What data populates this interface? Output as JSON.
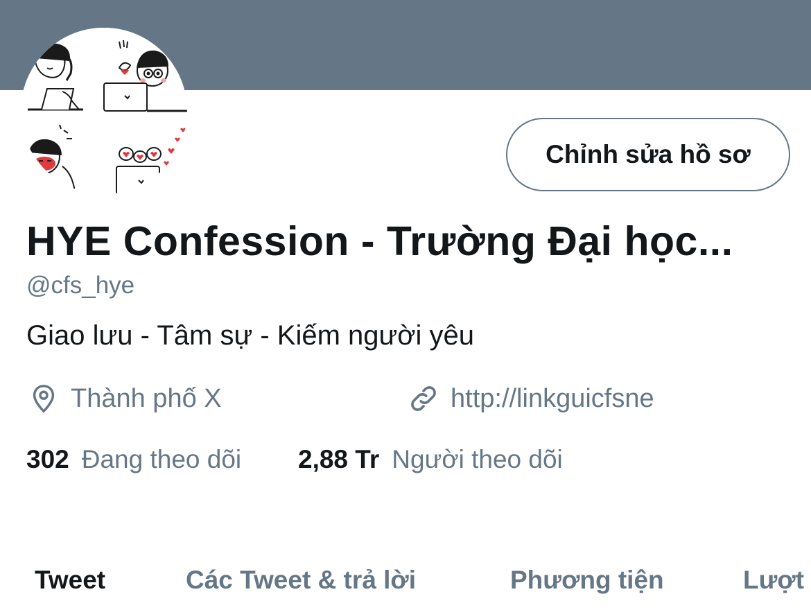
{
  "profile": {
    "edit_button": "Chỉnh sửa hồ sơ",
    "display_name": "HYE Confession - Trường Đại học...",
    "handle": "@cfs_hye",
    "bio": "Giao lưu - Tâm sự - Kiếm người yêu",
    "location": "Thành phố X",
    "link": "http://linkguicfsne",
    "following_count": "302",
    "following_label": "Đang theo dõi",
    "followers_count": "2,88 Tr",
    "followers_label": "Người theo dõi"
  },
  "tabs": [
    {
      "label": "Tweet",
      "active": true
    },
    {
      "label": "Các Tweet & trả lời",
      "active": false
    },
    {
      "label": "Phương tiện",
      "active": false
    },
    {
      "label": "Lượt",
      "active": false
    }
  ],
  "colors": {
    "banner": "#657786",
    "secondary_text": "#657786",
    "primary_text": "#14171a",
    "heart": "#e0393e"
  },
  "icons": {
    "location": "location-pin-icon",
    "link": "link-icon"
  }
}
